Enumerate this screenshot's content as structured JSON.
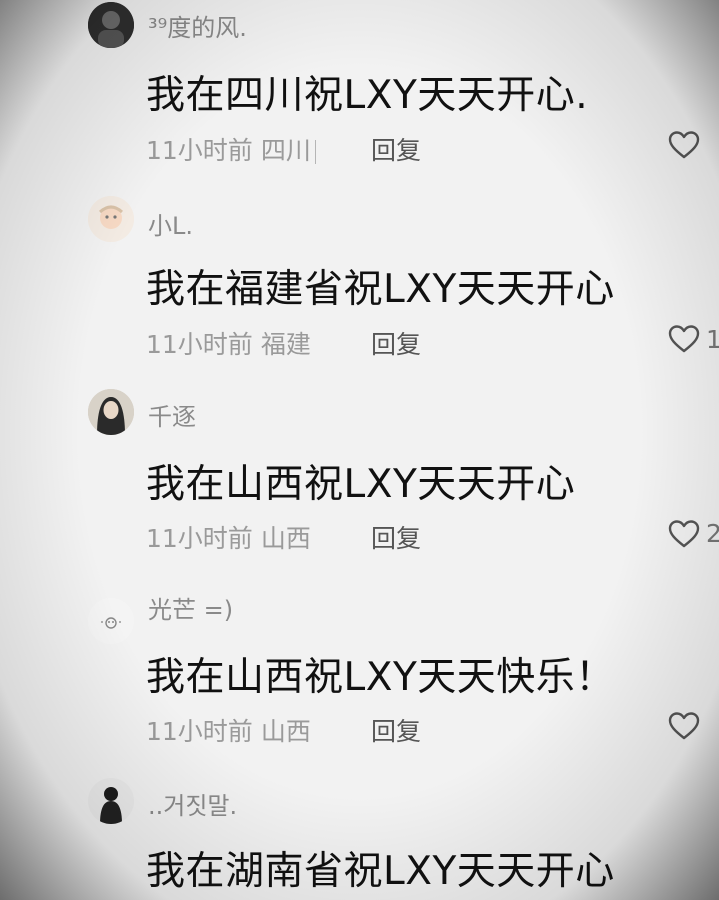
{
  "comments": [
    {
      "username": "³⁹度的风.",
      "content": "我在四川祝LXY天天开心.",
      "time": "11小时前",
      "location": "四川",
      "reply_label": "回复",
      "like_count": "",
      "avatar": "avatar-dark"
    },
    {
      "username": "小L.",
      "content": "我在福建省祝LXY天天开心",
      "time": "11小时前",
      "location": "福建",
      "reply_label": "回复",
      "like_count": "1",
      "avatar": "avatar-light"
    },
    {
      "username": "千逐",
      "content": "我在山西祝LXY天天开心",
      "time": "11小时前",
      "location": "山西",
      "reply_label": "回复",
      "like_count": "2",
      "avatar": "avatar-portrait"
    },
    {
      "username": "光芒 =)",
      "content": "我在山西祝LXY天天快乐！",
      "time": "11小时前",
      "location": "山西",
      "reply_label": "回复",
      "like_count": "",
      "avatar": "avatar-small-figure"
    },
    {
      "username": "..거짓말.",
      "content": "我在湖南省祝LXY天天开心",
      "time": "",
      "location": "",
      "reply_label": "",
      "like_count": "",
      "avatar": "avatar-dark-figure"
    }
  ]
}
